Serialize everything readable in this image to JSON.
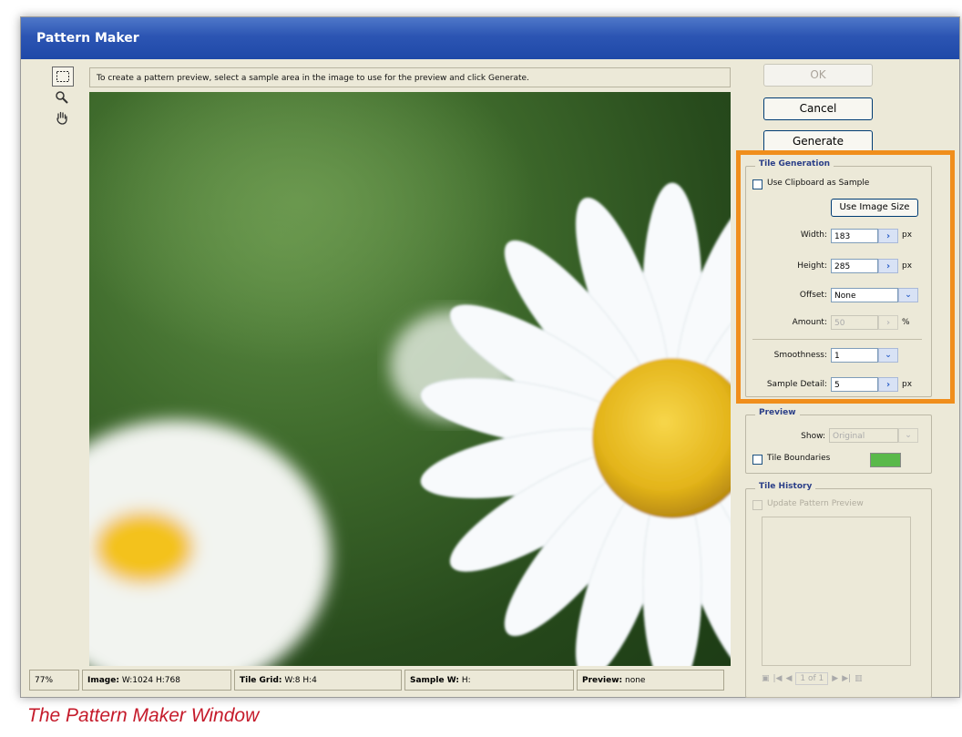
{
  "window": {
    "title": "Pattern Maker"
  },
  "instruction": "To create a pattern preview, select a sample area in the image to use for the preview and click Generate.",
  "buttons": {
    "ok": "OK",
    "cancel": "Cancel",
    "generate": "Generate"
  },
  "tile_generation": {
    "legend": "Tile Generation",
    "use_clipboard_label": "Use Clipboard as Sample",
    "use_image_size_label": "Use Image Size",
    "width_label": "Width:",
    "width_value": "183",
    "width_unit": "px",
    "height_label": "Height:",
    "height_value": "285",
    "height_unit": "px",
    "offset_label": "Offset:",
    "offset_value": "None",
    "amount_label": "Amount:",
    "amount_value": "50",
    "amount_unit": "%",
    "smoothness_label": "Smoothness:",
    "smoothness_value": "1",
    "sample_detail_label": "Sample Detail:",
    "sample_detail_value": "5",
    "sample_detail_unit": "px"
  },
  "preview_group": {
    "legend": "Preview",
    "show_label": "Show:",
    "show_value": "Original",
    "tile_boundaries_label": "Tile Boundaries",
    "tile_boundaries_color": "#5ab94a"
  },
  "tile_history": {
    "legend": "Tile History",
    "update_label": "Update Pattern Preview",
    "counter": "1 of 1"
  },
  "status": {
    "zoom": "77%",
    "image_label": "Image:",
    "image_value": "W:1024 H:768",
    "tile_grid_label": "Tile Grid:",
    "tile_grid_value": "W:8 H:4",
    "sample_label": "Sample W:",
    "sample_value": "H:",
    "preview_label": "Preview:",
    "preview_value": "none"
  },
  "caption": "The Pattern Maker Window",
  "colors": {
    "highlight": "#f08e1c",
    "caption": "#c51b2b",
    "title_bar": "#2c55b3"
  }
}
